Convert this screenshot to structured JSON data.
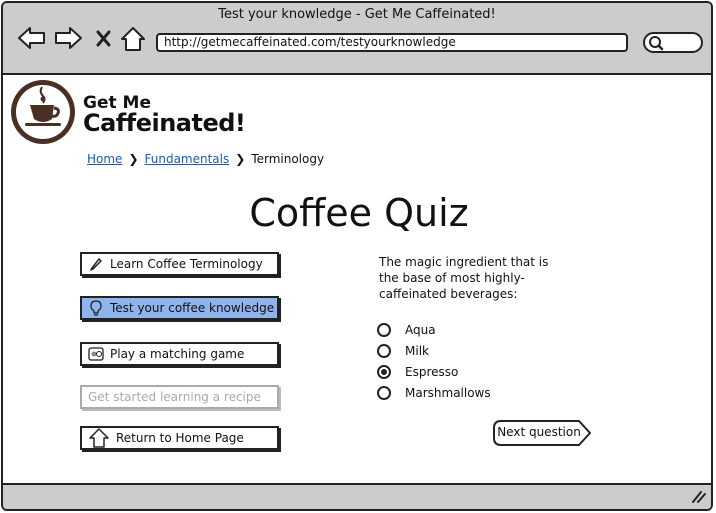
{
  "window": {
    "title": "Test your knowledge - Get Me Caffeinated!"
  },
  "toolbar": {
    "url": "http://getmecaffeinated.com/testyourknowledge"
  },
  "brand": {
    "line1": "Get Me",
    "line2": "Caffeinated!"
  },
  "breadcrumb": {
    "home": "Home",
    "fundamentals": "Fundamentals",
    "current": "Terminology",
    "separator": "❯"
  },
  "page": {
    "title": "Coffee Quiz"
  },
  "menu": {
    "learn": "Learn Coffee Terminology",
    "test": "Test your coffee knowledge",
    "match": "Play a matching game",
    "recipe": "Get started learning a recipe",
    "home": "Return to Home Page"
  },
  "quiz": {
    "question": "The magic ingredient that is the base of most highly-caffeinated beverages:",
    "options": [
      "Aqua",
      "Milk",
      "Espresso",
      "Marshmallows"
    ],
    "selected": "Espresso",
    "next": "Next question"
  },
  "colors": {
    "selected_button": "#8fb4ee",
    "chrome": "#cccccc",
    "link": "#1a5bb3"
  }
}
